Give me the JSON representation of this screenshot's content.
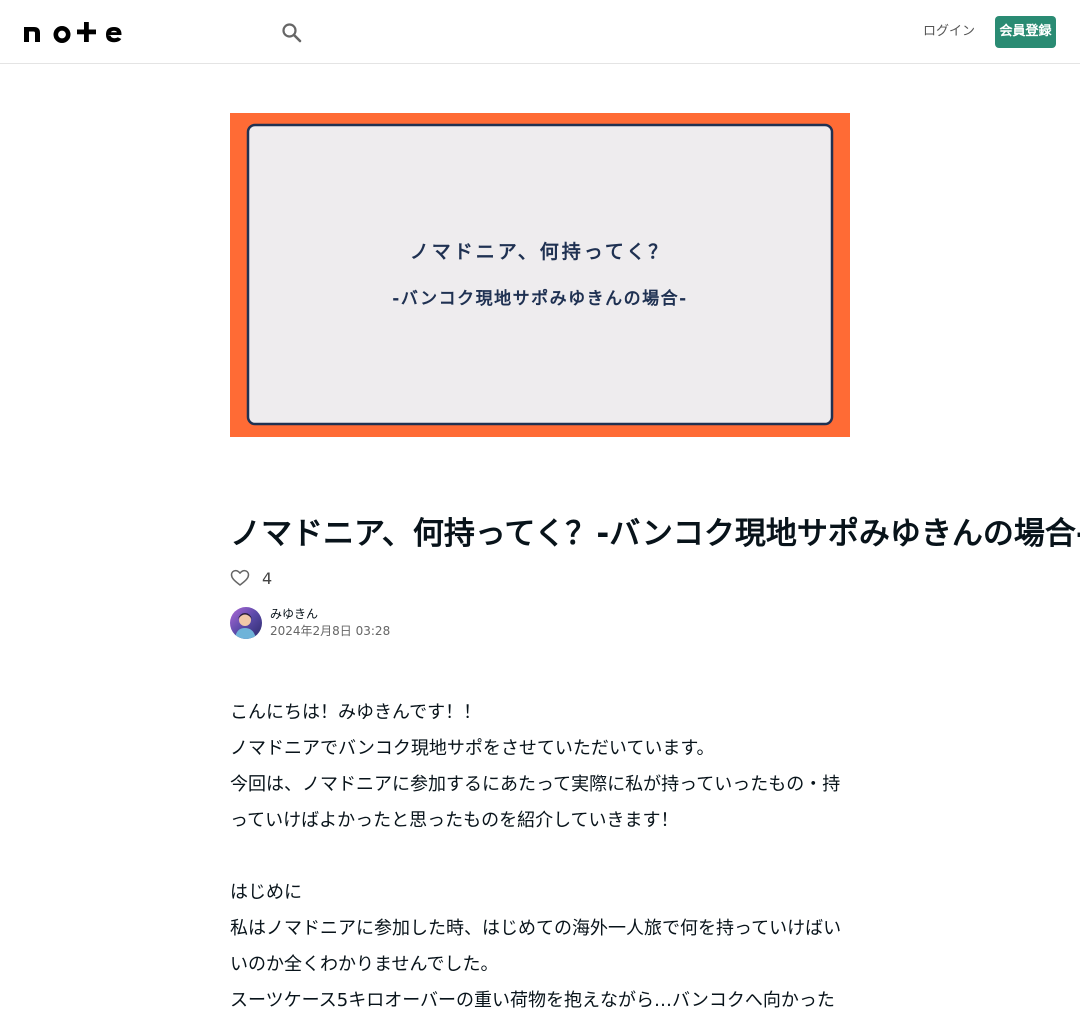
{
  "header": {
    "logo_text": "note",
    "login_label": "ログイン",
    "signup_label": "会員登録"
  },
  "hero": {
    "line1": "ノマドニア、何持ってく？",
    "line2": "-バンコク現地サポみゆきんの場合-",
    "frame_color": "#ff6b35",
    "panel_color": "#eeecee",
    "text_color": "#1f3152"
  },
  "article": {
    "title": "ノマドニア、何持ってく？-バンコク現地サポみゆきんの場合-",
    "like_count": "4",
    "author_name": "みゆきん",
    "date": "2024年2月8日 03:28",
    "paragraphs": [
      "こんにちは！みゆきんです！！",
      "ノマドニアでバンコク現地サポをさせていただいています。",
      "今回は、ノマドニアに参加するにあたって実際に私が持っていったもの・持っていけばよかったと思ったものを紹介していきます！",
      "",
      "はじめに",
      "私はノマドニアに参加した時、はじめての海外一人旅で何を持っていけばいいのか全くわかりませんでした。",
      "スーツケース5キロオーバーの重い荷物を抱えながら…バンコクへ向かった"
    ]
  },
  "brand": {
    "accent": "#2a8b73"
  }
}
